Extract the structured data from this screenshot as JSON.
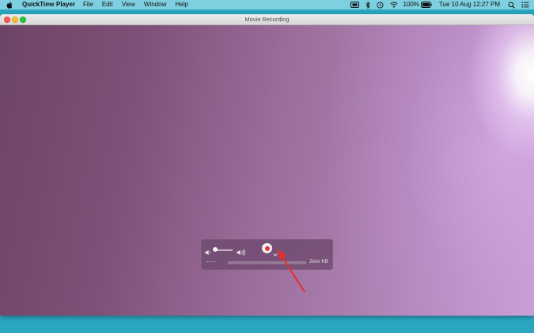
{
  "menubar": {
    "app_name": "QuickTime Player",
    "menus": [
      "File",
      "Edit",
      "View",
      "Window",
      "Help"
    ],
    "battery_percent": "100%",
    "datetime": "Tue 10 Aug  12:27 PM"
  },
  "window": {
    "title": "Movie Recording"
  },
  "hud": {
    "elapsed_time": "--:--",
    "file_size": "Zero KB",
    "volume_level": 0.05
  },
  "colors": {
    "record_red": "#e8323c",
    "annotation_arrow": "#e62e2e",
    "menubar_bg": "#7ecfe0",
    "desktop_bg": "#2aa6c0"
  },
  "icons": [
    "apple-icon",
    "screen-mirror-icon",
    "bluetooth-icon",
    "wifi-icon",
    "time-machine-icon",
    "battery-icon",
    "search-icon",
    "control-center-icon",
    "speaker-low-icon",
    "speaker-high-icon",
    "record-icon",
    "chevron-down-icon"
  ]
}
